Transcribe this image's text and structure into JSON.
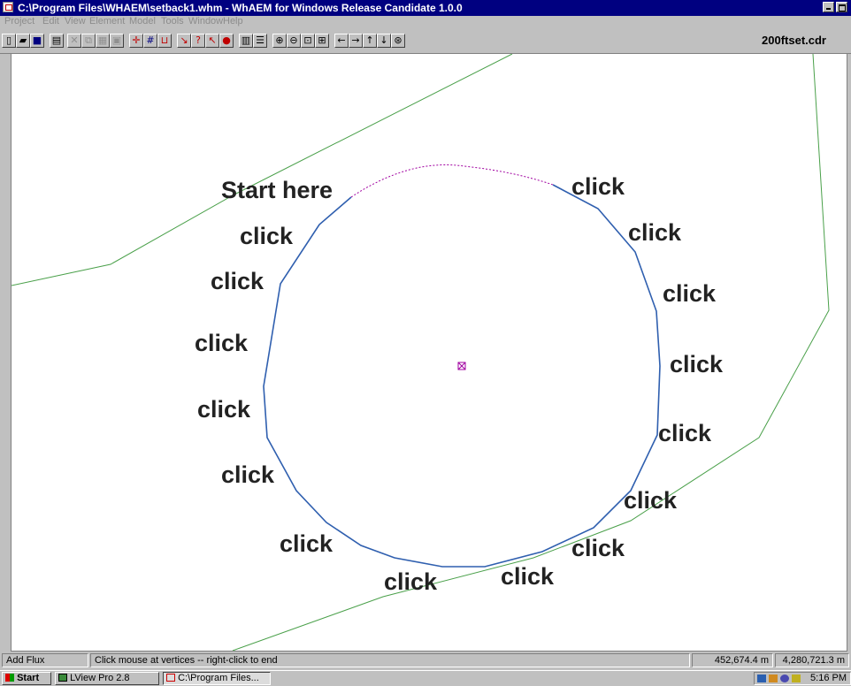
{
  "window": {
    "title": "C:\\Program Files\\WHAEM\\setback1.whm - WhAEM for Windows Release Candidate 1.0.0",
    "filename": "200ftset.cdr"
  },
  "menu": [
    "Project",
    "Edit",
    "View",
    "Element",
    "Model",
    "Tools",
    "Window",
    "Help"
  ],
  "canvas": {
    "start_label": "Start here",
    "click_label": "click",
    "colors": {
      "boundary": "#2f5faf",
      "guide": "#a000a0",
      "road": "#4aa04a"
    }
  },
  "status": {
    "mode": "Add Flux",
    "hint": "Click mouse at vertices -- right-click to end",
    "x_coord": "452,674.4 m",
    "y_coord": "4,280,721.3 m"
  },
  "taskbar": {
    "start": "Start",
    "tasks": [
      "LView Pro 2.8",
      "C:\\Program Files..."
    ],
    "clock": "5:16 PM"
  }
}
